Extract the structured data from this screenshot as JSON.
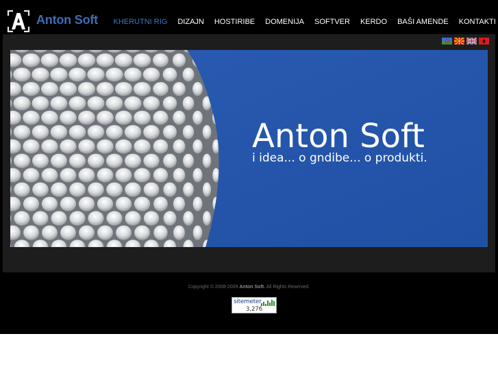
{
  "brand": {
    "name": "Anton Soft"
  },
  "nav": {
    "items": [
      {
        "label": "KHERUTNI RIG",
        "active": true
      },
      {
        "label": "DIZAJN",
        "active": false
      },
      {
        "label": "HOSTIRIBE",
        "active": false
      },
      {
        "label": "DOMENIJA",
        "active": false
      },
      {
        "label": "SOFTVER",
        "active": false
      },
      {
        "label": "KERDO",
        "active": false
      },
      {
        "label": "BAŠI AMENDE",
        "active": false
      },
      {
        "label": "KONTAKTI",
        "active": false
      }
    ]
  },
  "languages": [
    {
      "icon": "romani-flag-icon"
    },
    {
      "icon": "macedonia-flag-icon"
    },
    {
      "icon": "uk-flag-icon"
    },
    {
      "icon": "albania-flag-icon"
    }
  ],
  "banner": {
    "title": "Anton Soft",
    "tagline": "i idea... o gndibe... o produkti."
  },
  "footer": {
    "copyright": "Copyright © 2008-2009",
    "owner": "Anton Soft.",
    "rights": "All Rights Reserved."
  },
  "sitemeter": {
    "label": "sitemeter",
    "count": "3,276"
  },
  "colors": {
    "accent": "#3a78c8",
    "brand": "#3d6db5",
    "banner_sky": "#2552a6",
    "background": "#000000",
    "panel": "#1d1d1d"
  }
}
